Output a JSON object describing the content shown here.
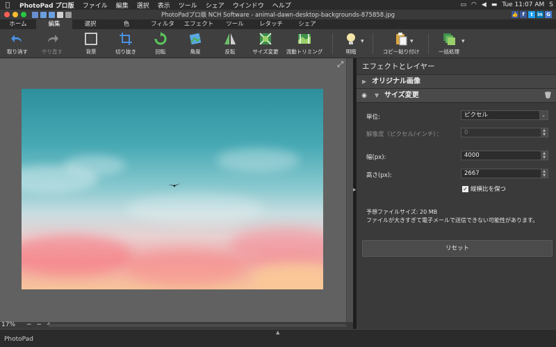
{
  "menubar": {
    "app": "PhotoPad プロ版",
    "items": [
      "ファイル",
      "編集",
      "選択",
      "表示",
      "ツール",
      "シェア",
      "ウインドウ",
      "ヘルプ"
    ],
    "clock": "Tue 11:07 AM",
    "user": "S"
  },
  "window": {
    "title": "PhotoPadプロ版 NCH Software - animal-dawn-desktop-backgrounds-875858.jpg",
    "social": [
      "👍",
      "f",
      "t",
      "in",
      "G"
    ]
  },
  "tabs": [
    "ホーム",
    "編集",
    "選択",
    "色",
    "フィルタ",
    "エフェクト",
    "ツール",
    "レタッチ",
    "シェア"
  ],
  "active_tab": "編集",
  "toolbar": {
    "undo": "取り消す",
    "redo": "やり直す",
    "background": "背景",
    "crop": "切り抜き",
    "rotate": "回転",
    "angle": "角度",
    "flip": "反転",
    "resize": "サイズ変更",
    "liquid_crop": "流動トリミング",
    "brightness": "明暗",
    "copy_paste": "コピー貼り付け",
    "batch": "一括処理"
  },
  "canvas": {
    "zoom": "17%",
    "zoom_controls": "− − +"
  },
  "panel": {
    "title": "エフェクトとレイヤー",
    "original": "オリジナル画像",
    "resize_section": "サイズ変更",
    "unit_label": "単位:",
    "unit_value": "ピクセル",
    "resolution_label": "解像度（ピクセル/インチ）：",
    "resolution_value": "0",
    "width_label": "幅(px):",
    "width_value": "4000",
    "height_label": "高さ(px):",
    "height_value": "2667",
    "keep_ratio": "縦横比を保つ",
    "estimate": "予想ファイルサイズ:  20 MB",
    "warning": "ファイルが大きすぎて電子メールで送信できない可能性があります。",
    "reset": "リセット"
  },
  "status": "PhotoPad"
}
